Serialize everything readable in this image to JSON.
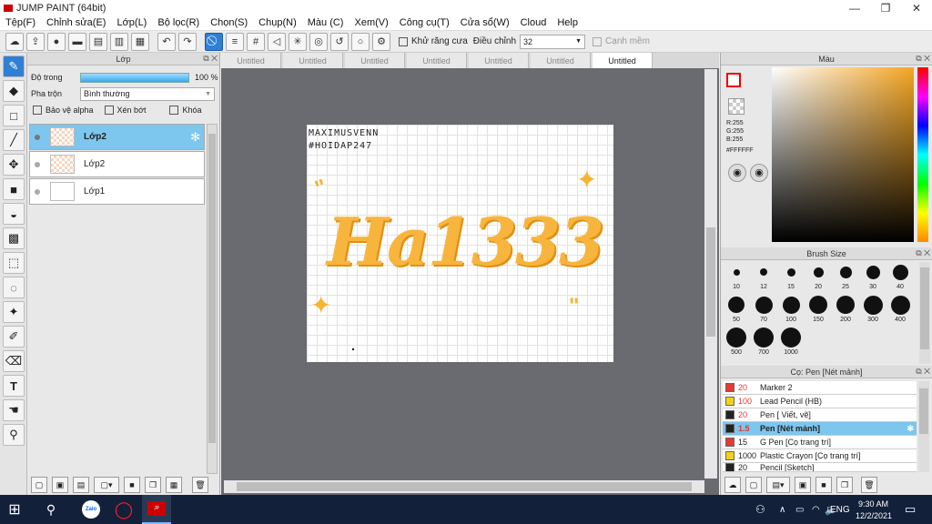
{
  "window": {
    "title": "JUMP PAINT (64bit)"
  },
  "menu": [
    "Tệp(F)",
    "Chỉnh sửa(E)",
    "Lớp(L)",
    "Bộ lọc(R)",
    "Chọn(S)",
    "Chụp(N)",
    "Màu (C)",
    "Xem(V)",
    "Công cụ(T)",
    "Cửa sổ(W)",
    "Cloud",
    "Help"
  ],
  "toolbar": {
    "antialias_label": "Khử răng cưa",
    "adjust_label": "Điều chỉnh",
    "adjust_value": "32",
    "smooth_label": "Cạnh mềm"
  },
  "layers": {
    "title": "Lớp",
    "opacity_label": "Độ trong",
    "opacity_value": "100 %",
    "opacity_fraction": 1.0,
    "blend_label": "Pha trộn",
    "blend_value": "Bình thường",
    "protect_alpha": "Bảo vệ alpha",
    "clip": "Xén bớt",
    "lock": "Khóa",
    "items": [
      {
        "name": "Lớp2",
        "selected": true
      },
      {
        "name": "Lớp2",
        "selected": false
      },
      {
        "name": "Lớp1",
        "selected": false
      }
    ]
  },
  "tabs": [
    "Untitled",
    "Untitled",
    "Untitled",
    "Untitled",
    "Untitled",
    "Untitled",
    "Untitled"
  ],
  "canvas": {
    "handwriting_1": "MAXIMUSVENN",
    "handwriting_2": "#HOIDAP247",
    "art_text": "Ha1333"
  },
  "color": {
    "title": "Màu",
    "r": "R:255",
    "g": "G:255",
    "b": "B:255",
    "hex": "#FFFFFF"
  },
  "brush": {
    "title": "Brush Size",
    "sizes": [
      "10",
      "12",
      "15",
      "20",
      "25",
      "30",
      "40",
      "50",
      "70",
      "100",
      "150",
      "200",
      "300",
      "400",
      "500",
      "700",
      "1000"
    ]
  },
  "pens": {
    "title": "Cọ: Pen [Nét mảnh]",
    "items": [
      {
        "value": "20",
        "name": "Marker 2",
        "color": "#e53935"
      },
      {
        "value": "100",
        "name": "Lead Pencil (HB)",
        "color": "#f0d21a"
      },
      {
        "value": "20",
        "name": "Pen [ Viết, vẽ]",
        "color": "#222222"
      },
      {
        "value": "1.5",
        "name": "Pen [Nét mảnh]",
        "color": "#222222"
      },
      {
        "value": "15",
        "name": "G Pen [Cọ trang trí]",
        "color": "#e53935"
      },
      {
        "value": "1000",
        "name": "Plastic Crayon [Cọ trang trí]",
        "color": "#f0d21a"
      },
      {
        "value": "20",
        "name": "Pencil [Sketch]",
        "color": "#222222"
      }
    ]
  },
  "taskbar": {
    "time": "9:30 AM",
    "date": "12/2/2021",
    "lang": "ENG"
  }
}
